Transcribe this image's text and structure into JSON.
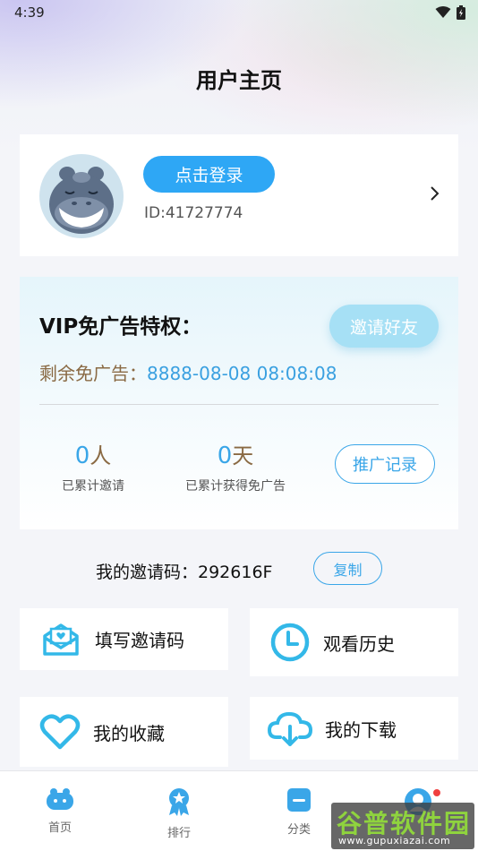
{
  "status_bar": {
    "time": "4:39"
  },
  "header": {
    "title": "用户主页"
  },
  "profile": {
    "login_label": "点击登录",
    "user_id": "ID:41727774"
  },
  "vip": {
    "title": "VIP免广告特权：",
    "invite_button": "邀请好友",
    "remaining_label": "剩余免广告：",
    "remaining_value": "8888-08-08 08:08:08",
    "stats": [
      {
        "value": "0",
        "unit": "人",
        "label": "已累计邀请"
      },
      {
        "value": "0",
        "unit": "天",
        "label": "已累计获得免广告"
      }
    ],
    "promo_button": "推广记录"
  },
  "invite_code": {
    "text": "我的邀请码：292616F",
    "copy_label": "复制"
  },
  "tiles": [
    {
      "label": "填写邀请码",
      "icon": "mail-heart-icon"
    },
    {
      "label": "观看历史",
      "icon": "clock-icon"
    },
    {
      "label": "我的收藏",
      "icon": "heart-icon"
    },
    {
      "label": "我的下载",
      "icon": "cloud-download-icon"
    }
  ],
  "tab_bar": [
    {
      "label": "首页",
      "icon": "home-hippo-icon"
    },
    {
      "label": "排行",
      "icon": "ranking-badge-icon"
    },
    {
      "label": "分类",
      "icon": "category-icon"
    },
    {
      "label": "",
      "icon": "profile-icon"
    }
  ],
  "watermark": {
    "title": "谷普软件园",
    "url": "www.gupuxiazai.com"
  },
  "colors": {
    "accent": "#2ea7f5",
    "gold_text": "#8a6a44",
    "background": "#f4f5f9"
  }
}
